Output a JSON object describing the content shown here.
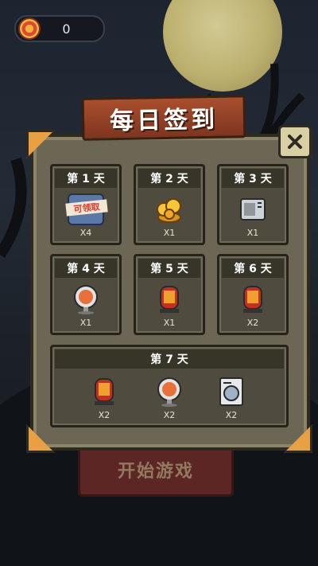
{
  "hud": {
    "coin_count": "0"
  },
  "title": "每日签到",
  "start_button": "开始游戏",
  "days": [
    {
      "label": "第 1 天",
      "items": [
        {
          "icon": "claimable-badge-icon",
          "badge_text": "可领取",
          "qty": "X4"
        }
      ]
    },
    {
      "label": "第 2 天",
      "items": [
        {
          "icon": "gold-coins-icon",
          "qty": "X1"
        }
      ]
    },
    {
      "label": "第 3 天",
      "items": [
        {
          "icon": "air-conditioner-icon",
          "qty": "X1"
        }
      ]
    },
    {
      "label": "第 4 天",
      "items": [
        {
          "icon": "fan-icon",
          "qty": "X1"
        }
      ]
    },
    {
      "label": "第 5 天",
      "items": [
        {
          "icon": "heater-icon",
          "qty": "X1"
        }
      ]
    },
    {
      "label": "第 6 天",
      "items": [
        {
          "icon": "heater-icon",
          "qty": "X2"
        }
      ]
    },
    {
      "label": "第 7 天",
      "items": [
        {
          "icon": "heater-icon",
          "qty": "X2"
        },
        {
          "icon": "fan-icon",
          "qty": "X2"
        },
        {
          "icon": "washing-machine-icon",
          "qty": "X2"
        }
      ]
    }
  ]
}
